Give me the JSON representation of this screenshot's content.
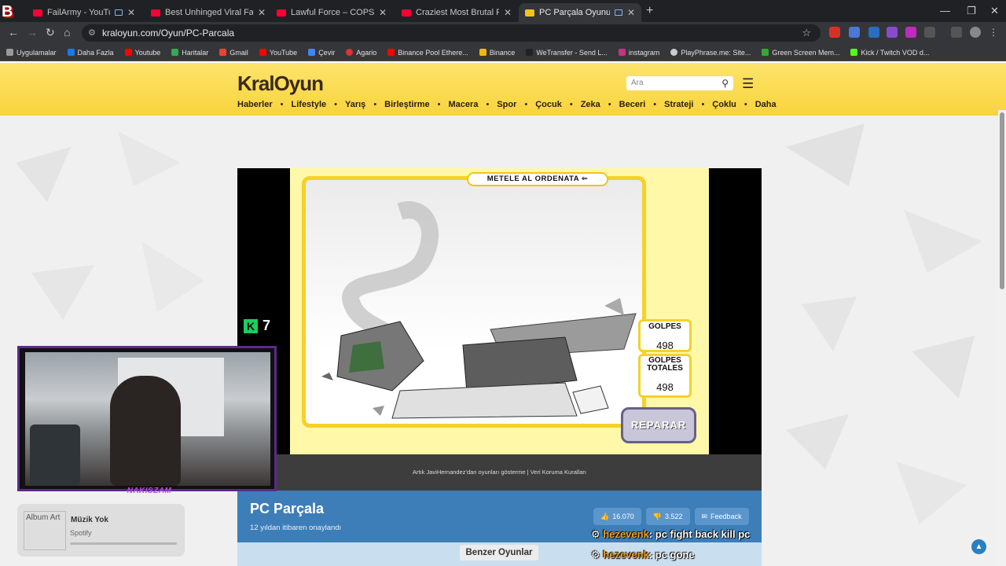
{
  "browser": {
    "tabs": [
      {
        "label": "FailArmy - YouTube",
        "kind": "yt"
      },
      {
        "label": "Best Unhinged Viral Fails | What",
        "kind": "yt"
      },
      {
        "label": "Lawful Force – COPSCAM - You",
        "kind": "yt"
      },
      {
        "label": "Craziest Most Brutal Police Das",
        "kind": "yt"
      },
      {
        "label": "PC Parçala Oyunu - Online",
        "kind": "kr",
        "active": true
      }
    ],
    "url": "kraloyun.com/Oyun/PC-Parcala",
    "bookmarks": [
      "Uygulamalar",
      "Daha Fazla",
      "Youtube",
      "Haritalar",
      "Gmail",
      "YouTube",
      "Çevir",
      "Agario",
      "Binance Pool Ethere...",
      "Binance",
      "WeTransfer - Send L...",
      "instagram",
      "PlayPhrase.me: Site...",
      "Green Screen Mem...",
      "Kick / Twitch VOD d..."
    ]
  },
  "site": {
    "logo": "KralOyun",
    "search_placeholder": "Ara",
    "categories": [
      "Haberler",
      "Lifestyle",
      "Yarış",
      "Birleştirme",
      "Macera",
      "Spor",
      "Çocuk",
      "Zeka",
      "Beceri",
      "Strateji",
      "Çoklu",
      "Daha"
    ]
  },
  "game": {
    "banner": "METELE AL ORDENATA ⇐",
    "golpes_label": "GOLPES",
    "golpes_value": "498",
    "golpes_totales_label_1": "GOLPES",
    "golpes_totales_label_2": "TOTALES",
    "golpes_totales_value": "498",
    "reparar": "REPARAR",
    "k_badge": "7",
    "footer": "Artık JaviHernandez'dan oyunları gösterme | Veri Koruma Kuralları"
  },
  "info": {
    "title": "PC Parçala",
    "subtitle": "12 yıldan itibaren onaylandı",
    "likes": "16.070",
    "dislikes": "3.522",
    "feedback": "Feedback",
    "similar": "Benzer Oyunlar"
  },
  "stream": {
    "cam_label": "NAKISZAM",
    "album_alt": "Album Art",
    "track": "Müzik Yok",
    "source": "Spotify",
    "chat": [
      {
        "nick": "hezevenk",
        "msg": ": pc fight back kill pc"
      },
      {
        "nick": "hezevenk",
        "msg": ": pc gone"
      }
    ]
  }
}
